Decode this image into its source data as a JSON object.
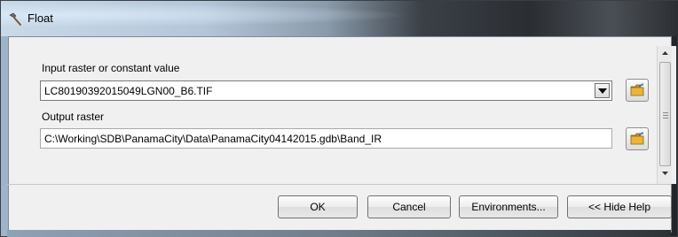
{
  "window": {
    "title": "Float",
    "title_icon": "hammer-tool-icon"
  },
  "input_raster": {
    "label": "Input raster or constant value",
    "value": "LC80190392015049LGN00_B6.TIF",
    "dropdown_icon": "chevron-down-icon",
    "browse_icon": "open-folder-icon"
  },
  "output_raster": {
    "label": "Output raster",
    "value": "C:\\Working\\SDB\\PanamaCity\\Data\\PanamaCity04142015.gdb\\Band_IR",
    "browse_icon": "open-folder-icon"
  },
  "buttons": {
    "ok": "OK",
    "cancel": "Cancel",
    "environments": "Environments...",
    "hide_help": "<< Hide Help"
  },
  "colors": {
    "folder_yellow": "#e8b53a",
    "dialog_bg": "#f0f0f0"
  }
}
